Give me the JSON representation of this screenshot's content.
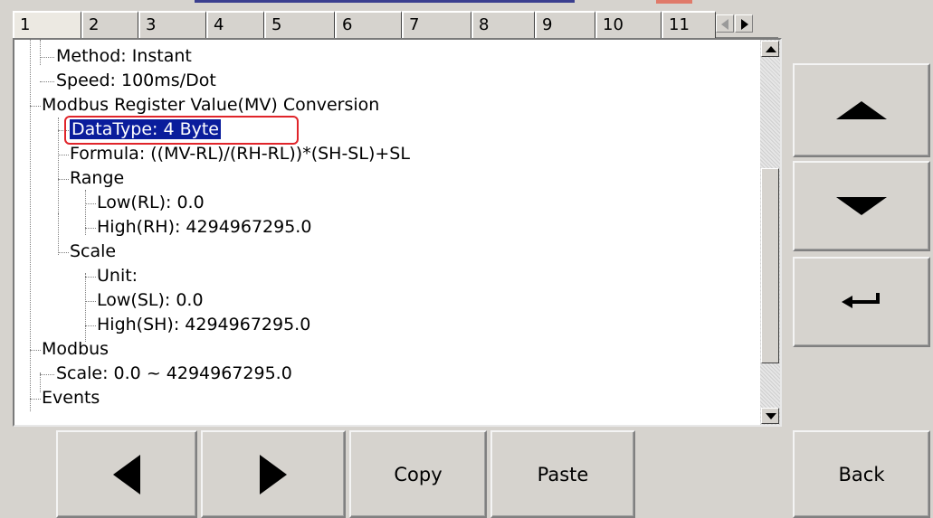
{
  "tabs": [
    "1",
    "2",
    "3",
    "4",
    "5",
    "6",
    "7",
    "8",
    "9",
    "10",
    "11"
  ],
  "active_tab": "1",
  "tree": {
    "items": [
      "Method: Instant",
      "Speed: 100ms/Dot",
      "Modbus Register Value(MV) Conversion",
      "DataType: 4 Byte",
      "Formula: ((MV-RL)/(RH-RL))*(SH-SL)+SL",
      "Range",
      "Low(RL): 0.0",
      "High(RH): 4294967295.0",
      "Scale",
      "Unit:",
      "Low(SL): 0.0",
      "High(SH): 4294967295.0",
      "Modbus",
      "Scale: 0.0 ~ 4294967295.0",
      "Events"
    ],
    "selected": "DataType: 4 Byte"
  },
  "side_buttons": {
    "up": "up-arrow-icon",
    "down": "down-arrow-icon",
    "enter": "enter-icon"
  },
  "bottom_buttons": {
    "prev": "left-arrow-icon",
    "next": "right-arrow-icon",
    "copy": "Copy",
    "paste": "Paste",
    "back": "Back"
  },
  "colors": {
    "selection_bg": "#0a1d9c",
    "selection_frame": "#e0242a",
    "chrome": "#d6d3ce"
  }
}
